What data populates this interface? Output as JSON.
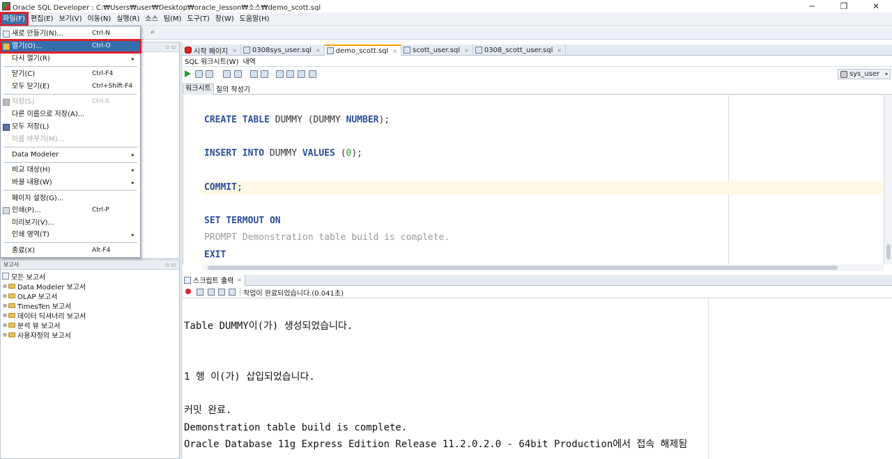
{
  "window": {
    "title": "Oracle SQL Developer : C:₩Users₩user₩Desktop₩oracle_lesson₩소스₩demo_scott.sql",
    "controls": {
      "minimize": "─",
      "maximize": "❐",
      "close": "✕"
    }
  },
  "menubar": {
    "items": [
      "파일(F)",
      "편집(E)",
      "보기(V)",
      "이동(N)",
      "실행(R)",
      "소스",
      "팀(M)",
      "도구(T)",
      "창(W)",
      "도움말(H)"
    ]
  },
  "file_menu": {
    "items": [
      {
        "label": "새로 만들기(N)...",
        "shortcut": "Ctrl-N",
        "icon": "new-file-icon",
        "enabled": true
      },
      {
        "label": "열기(O)...",
        "shortcut": "Ctrl-O",
        "icon": "open-folder-icon",
        "enabled": true,
        "highlighted": true
      },
      {
        "label": "다시 열기(R)",
        "shortcut": "",
        "submenu": true,
        "enabled": true
      },
      {
        "label": "닫기(C)",
        "shortcut": "Ctrl-F4",
        "enabled": true
      },
      {
        "label": "모두 닫기(E)",
        "shortcut": "Ctrl+Shift-F4",
        "enabled": true
      },
      {
        "label": "저장(S)",
        "shortcut": "Ctrl-S",
        "icon": "save-icon",
        "enabled": false
      },
      {
        "label": "다른 이름으로 저장(A)...",
        "shortcut": "",
        "enabled": true
      },
      {
        "label": "모두 저장(L)",
        "shortcut": "",
        "icon": "save-all-icon",
        "enabled": true
      },
      {
        "label": "이름 바꾸기(M)...",
        "shortcut": "",
        "enabled": false
      },
      {
        "label": "Data Modeler",
        "shortcut": "",
        "submenu": true,
        "enabled": true
      },
      {
        "label": "비교 대상(H)",
        "shortcut": "",
        "submenu": true,
        "enabled": true
      },
      {
        "label": "바꿀 내용(W)",
        "shortcut": "",
        "submenu": true,
        "enabled": true
      },
      {
        "label": "페이지 설정(G)...",
        "shortcut": "",
        "enabled": true
      },
      {
        "label": "인쇄(P)...",
        "shortcut": "Ctrl-P",
        "icon": "print-icon",
        "enabled": true
      },
      {
        "label": "미리보기(V)...",
        "shortcut": "",
        "enabled": true
      },
      {
        "label": "인쇄 영역(T)",
        "shortcut": "",
        "submenu": true,
        "enabled": true
      },
      {
        "label": "종료(X)",
        "shortcut": "Alt-F4",
        "enabled": true
      }
    ],
    "submenu_arrow": "▸"
  },
  "reports_panel": {
    "title": "보고서",
    "root": "모든 보고서",
    "children": [
      "Data Modeler 보고서",
      "OLAP 보고서",
      "TimesTen 보고서",
      "데이터 딕셔너리 보고서",
      "분석 뷰 보고서",
      "사용자정의 보고서"
    ]
  },
  "editor": {
    "tabs": [
      {
        "label": "시작 페이지",
        "active": false
      },
      {
        "label": "0308sys_user.sql",
        "active": false
      },
      {
        "label": "demo_scott.sql",
        "active": true
      },
      {
        "label": "scott_user.sql",
        "active": false
      },
      {
        "label": "0308_scott_user.sql",
        "active": false
      }
    ],
    "subtabs": [
      "SQL 워크시트(W)",
      "내역"
    ],
    "connection": "sys_user",
    "worksheet_tabs": [
      "워크시트",
      "질의 작성기"
    ],
    "code": [
      {
        "parts": [
          [
            "kw",
            "CREATE"
          ],
          [
            "plain",
            " "
          ],
          [
            "kw",
            "TABLE"
          ],
          [
            "plain",
            " DUMMY (DUMMY "
          ],
          [
            "kw",
            "NUMBER"
          ],
          [
            "plain",
            ");"
          ]
        ],
        "highlight": false
      },
      {
        "parts": [
          [
            "kw",
            "INSERT"
          ],
          [
            "plain",
            " "
          ],
          [
            "kw",
            "INTO"
          ],
          [
            "plain",
            " DUMMY "
          ],
          [
            "kw",
            "VALUES"
          ],
          [
            "plain",
            " ("
          ],
          [
            "num",
            "0"
          ],
          [
            "plain",
            ");"
          ]
        ],
        "highlight": false
      },
      {
        "parts": [
          [
            "kw",
            "COMMIT"
          ],
          [
            "plain",
            ";"
          ]
        ],
        "highlight": true
      },
      {
        "parts": [
          [
            "kw",
            "SET"
          ],
          [
            "plain",
            " "
          ],
          [
            "kw",
            "TERMOUT"
          ],
          [
            "plain",
            " "
          ],
          [
            "kw",
            "ON"
          ]
        ],
        "highlight": false
      },
      {
        "parts": [
          [
            "prompt",
            "PROMPT Demonstration table build is complete."
          ]
        ],
        "highlight": false
      },
      {
        "parts": [
          [
            "kw",
            "EXIT"
          ]
        ],
        "highlight": false
      }
    ]
  },
  "output": {
    "tab_label": "스크립트 출력",
    "status": "작업이 완료되었습니다.(0.041초)",
    "lines": [
      "Table DUMMY이(가) 생성되었습니다.",
      "1 행 이(가) 삽입되었습니다.",
      "커밋 완료.",
      "Demonstration table build is complete.",
      "Oracle Database 11g Express Edition Release 11.2.0.2.0 - 64bit Production에서 접속 해제됨"
    ]
  },
  "colors": {
    "keyword": "#2a4e9e",
    "menu_highlight": "#356dad",
    "annotation_red": "#e0202a"
  }
}
